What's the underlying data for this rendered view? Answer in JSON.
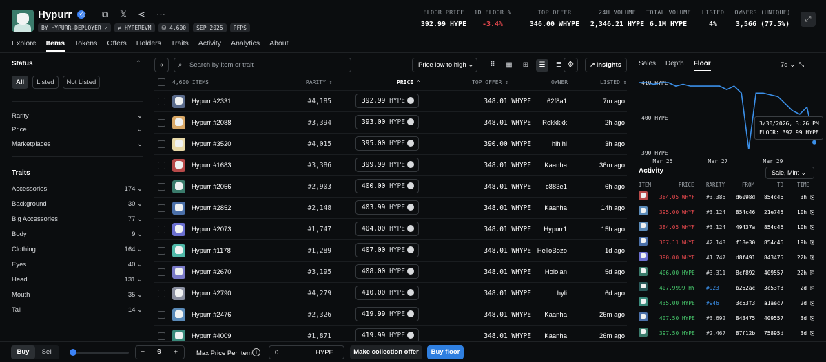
{
  "header": {
    "name": "Hypurr",
    "tags": [
      "BY HYPURR-DEPLOYER ✓",
      "⇄ HYPEREVM",
      "⛁ 4,600",
      "SEP 2025",
      "PFPS"
    ],
    "stats": [
      {
        "label": "FLOOR PRICE",
        "value": "392.99 HYPE",
        "color": "#ffffff"
      },
      {
        "label": "1D FLOOR %",
        "value": "-3.4%",
        "color": "#e5484d"
      },
      {
        "label": "TOP OFFER",
        "value": "346.00 WHYPE",
        "color": "#ffffff"
      },
      {
        "label": "24H VOLUME",
        "value": "2,346.21 HYPE",
        "color": "#ffffff"
      },
      {
        "label": "TOTAL VOLUME",
        "value": "6.1M HYPE",
        "color": "#ffffff"
      },
      {
        "label": "LISTED",
        "value": "4%",
        "color": "#ffffff"
      },
      {
        "label": "OWNERS (UNIQUE)",
        "value": "3,566 (77.5%)",
        "color": "#ffffff"
      }
    ]
  },
  "tabs": [
    "Explore",
    "Items",
    "Tokens",
    "Offers",
    "Holders",
    "Traits",
    "Activity",
    "Analytics",
    "About"
  ],
  "active_tab": "Items",
  "sidebar": {
    "status_title": "Status",
    "status_options": [
      "All",
      "Listed",
      "Not Listed"
    ],
    "filters": [
      "Rarity",
      "Price",
      "Marketplaces"
    ],
    "traits_title": "Traits",
    "traits": [
      {
        "name": "Accessories",
        "count": "174"
      },
      {
        "name": "Background",
        "count": "30"
      },
      {
        "name": "Big Accessories",
        "count": "77"
      },
      {
        "name": "Body",
        "count": "9"
      },
      {
        "name": "Clothing",
        "count": "164"
      },
      {
        "name": "Eyes",
        "count": "40"
      },
      {
        "name": "Head",
        "count": "131"
      },
      {
        "name": "Mouth",
        "count": "35"
      },
      {
        "name": "Tail",
        "count": "14"
      }
    ]
  },
  "toolbar": {
    "search_placeholder": "Search by item or trait",
    "sort": "Price low to high",
    "insights": "Insights"
  },
  "table": {
    "headers": {
      "items": "4,600 ITEMS",
      "rarity": "RARITY",
      "price": "PRICE",
      "top_offer": "TOP OFFER",
      "owner": "OWNER",
      "listed": "LISTED"
    },
    "rows": [
      {
        "name": "Hypurr #2331",
        "rarity": "#4,185",
        "price": "392.99",
        "currency": "HYPE",
        "offer": "348.01 WHYPE",
        "owner": "62f8a1",
        "listed": "7m ago",
        "bg": "#5a6b8c"
      },
      {
        "name": "Hypurr #2088",
        "rarity": "#3,394",
        "price": "393.00",
        "currency": "HYPE",
        "offer": "348.01 WHYPE",
        "owner": "Rekkkkk",
        "listed": "2h ago",
        "bg": "#d9a866"
      },
      {
        "name": "Hypurr #3520",
        "rarity": "#4,015",
        "price": "395.00",
        "currency": "HYPE",
        "offer": "390.00 WHYPE",
        "owner": "hlhlhl",
        "listed": "3h ago",
        "bg": "#e8d9a8"
      },
      {
        "name": "Hypurr #1683",
        "rarity": "#3,386",
        "price": "399.99",
        "currency": "HYPE",
        "offer": "348.01 WHYPE",
        "owner": "Kaanha",
        "listed": "36m ago",
        "bg": "#b84a4a"
      },
      {
        "name": "Hypurr #2056",
        "rarity": "#2,903",
        "price": "400.00",
        "currency": "HYPE",
        "offer": "348.01 WHYPE",
        "owner": "c883e1",
        "listed": "6h ago",
        "bg": "#3a7b6b"
      },
      {
        "name": "Hypurr #2852",
        "rarity": "#2,148",
        "price": "403.99",
        "currency": "HYPE",
        "offer": "348.01 WHYPE",
        "owner": "Kaanha",
        "listed": "14h ago",
        "bg": "#4a6fa8"
      },
      {
        "name": "Hypurr #2073",
        "rarity": "#1,747",
        "price": "404.00",
        "currency": "HYPE",
        "offer": "348.01 WHYPE",
        "owner": "Hypurr1",
        "listed": "15h ago",
        "bg": "#6a6fd0"
      },
      {
        "name": "Hypurr #1178",
        "rarity": "#1,289",
        "price": "407.00",
        "currency": "HYPE",
        "offer": "348.01 WHYPE",
        "owner": "HelloBozo",
        "listed": "1d ago",
        "bg": "#4fb8a8"
      },
      {
        "name": "Hypurr #2670",
        "rarity": "#3,195",
        "price": "408.00",
        "currency": "HYPE",
        "offer": "348.01 WHYPE",
        "owner": "Holojan",
        "listed": "5d ago",
        "bg": "#7a7ac8"
      },
      {
        "name": "Hypurr #2790",
        "rarity": "#4,279",
        "price": "410.00",
        "currency": "HYPE",
        "offer": "348.01 WHYPE",
        "owner": "hyli",
        "listed": "6d ago",
        "bg": "#8a8fa0"
      },
      {
        "name": "Hypurr #2476",
        "rarity": "#2,326",
        "price": "419.99",
        "currency": "HYPE",
        "offer": "348.01 WHYPE",
        "owner": "Kaanha",
        "listed": "26m ago",
        "bg": "#5a8ab8"
      },
      {
        "name": "Hypurr #4009",
        "rarity": "#1,871",
        "price": "419.99",
        "currency": "HYPE",
        "offer": "348.01 WHYPE",
        "owner": "Kaanha",
        "listed": "26m ago",
        "bg": "#3a8a7b"
      }
    ]
  },
  "right": {
    "tabs": [
      "Sales",
      "Depth",
      "Floor"
    ],
    "active": "Floor",
    "period": "7d",
    "chart_data": {
      "type": "line",
      "y_ticks": [
        "410 HYPE",
        "400 HYPE",
        "390 HYPE"
      ],
      "ylim": [
        390,
        410
      ],
      "x_ticks": [
        "Mar 25",
        "Mar 27",
        "Mar 29"
      ],
      "tooltip": [
        "3/30/2026, 3:26 PM",
        "FLOOR: 392.99 HYPE"
      ],
      "values": [
        410,
        410,
        409.5,
        410,
        410,
        409,
        409.5,
        409,
        409,
        409,
        409,
        409,
        408,
        409,
        407,
        391,
        407,
        407,
        406.5,
        406,
        404,
        402,
        401,
        403,
        392.99
      ],
      "color": "#3b8fe8"
    },
    "activity_title": "Activity",
    "activity_filter": "Sale, Mint",
    "activity_headers": [
      "ITEM",
      "PRICE",
      "RARITY",
      "FROM",
      "TO",
      "TIME"
    ],
    "activity": [
      {
        "price": "384.05 WHYF",
        "rarity": "#3,386",
        "from": "d6098d",
        "to": "854c46",
        "time": "3h",
        "pc": "#e5484d",
        "rc": "#d8dadd",
        "bg": "#b84a4a"
      },
      {
        "price": "395.00 WHYF",
        "rarity": "#3,124",
        "from": "854c46",
        "to": "21e745",
        "time": "10h",
        "pc": "#e5484d",
        "rc": "#d8dadd",
        "bg": "#5a8ab8"
      },
      {
        "price": "384.05 WHYF",
        "rarity": "#3,124",
        "from": "49437a",
        "to": "854c46",
        "time": "10h",
        "pc": "#e5484d",
        "rc": "#d8dadd",
        "bg": "#5a8ab8"
      },
      {
        "price": "387.11 WHYF",
        "rarity": "#2,148",
        "from": "f18e30",
        "to": "854c46",
        "time": "19h",
        "pc": "#e5484d",
        "rc": "#d8dadd",
        "bg": "#4a6fa8"
      },
      {
        "price": "390.00 WHYF",
        "rarity": "#1,747",
        "from": "d8f491",
        "to": "843475",
        "time": "22h",
        "pc": "#e5484d",
        "rc": "#d8dadd",
        "bg": "#6a6fd0"
      },
      {
        "price": "406.00 HYPE",
        "rarity": "#3,311",
        "from": "8cf892",
        "to": "409557",
        "time": "22h",
        "pc": "#46c46a",
        "rc": "#d8dadd",
        "bg": "#3a7b6b"
      },
      {
        "price": "407.9999 HY",
        "rarity": "#923",
        "from": "b262ac",
        "to": "3c53f3",
        "time": "2d",
        "pc": "#46c46a",
        "rc": "#3b8fe8",
        "bg": "#2a5a5a"
      },
      {
        "price": "435.00 HYPE",
        "rarity": "#946",
        "from": "3c53f3",
        "to": "a1aec7",
        "time": "2d",
        "pc": "#46c46a",
        "rc": "#3b8fe8",
        "bg": "#3a8a7b"
      },
      {
        "price": "407.50 HYPE",
        "rarity": "#3,692",
        "from": "843475",
        "to": "409557",
        "time": "3d",
        "pc": "#46c46a",
        "rc": "#d8dadd",
        "bg": "#4a6fa8"
      },
      {
        "price": "397.50 HYPE",
        "rarity": "#2,467",
        "from": "87f12b",
        "to": "75895d",
        "time": "3d",
        "pc": "#46c46a",
        "rc": "#d8dadd",
        "bg": "#3a7b6b"
      }
    ]
  },
  "bottom": {
    "buy": "Buy",
    "sell": "Sell",
    "qty": "0",
    "max_label": "Max Price Per Item",
    "max_value": "0",
    "max_unit": "HYPE",
    "make_offer": "Make collection offer",
    "buy_floor": "Buy floor"
  }
}
